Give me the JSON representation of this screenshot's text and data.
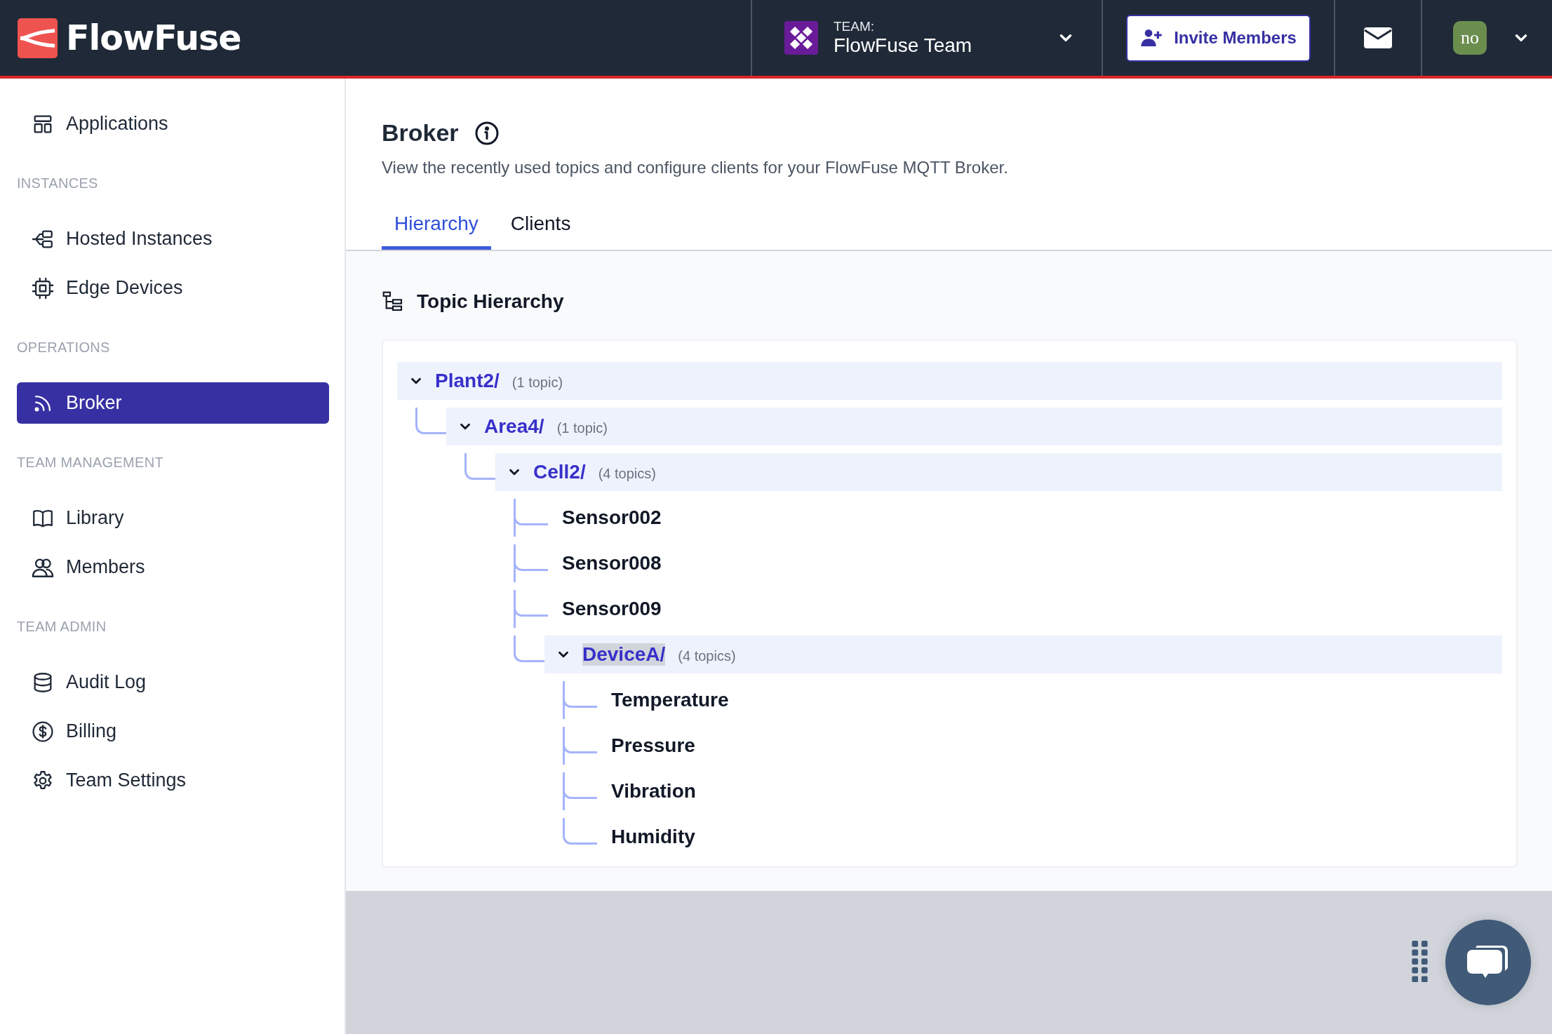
{
  "header": {
    "logo_text": "FlowFuse",
    "team": {
      "label": "TEAM:",
      "name": "FlowFuse Team"
    },
    "invite_button": "Invite Members",
    "avatar_initials": "no"
  },
  "sidebar": {
    "sections": [
      {
        "items": [
          {
            "label": "Applications",
            "kind": "applications",
            "selected": false
          }
        ]
      },
      {
        "title": "INSTANCES",
        "items": [
          {
            "label": "Hosted Instances",
            "kind": "hosted",
            "selected": false
          },
          {
            "label": "Edge Devices",
            "kind": "chip",
            "selected": false
          }
        ]
      },
      {
        "title": "OPERATIONS",
        "items": [
          {
            "label": "Broker",
            "kind": "broker",
            "selected": true
          }
        ]
      },
      {
        "title": "TEAM MANAGEMENT",
        "items": [
          {
            "label": "Library",
            "kind": "book",
            "selected": false
          },
          {
            "label": "Members",
            "kind": "users",
            "selected": false
          }
        ]
      },
      {
        "title": "TEAM ADMIN",
        "items": [
          {
            "label": "Audit Log",
            "kind": "database",
            "selected": false
          },
          {
            "label": "Billing",
            "kind": "dollar",
            "selected": false
          },
          {
            "label": "Team Settings",
            "kind": "gear",
            "selected": false
          }
        ]
      }
    ]
  },
  "page": {
    "title": "Broker",
    "description": "View the recently used topics and configure clients for your FlowFuse MQTT Broker."
  },
  "tabs": [
    {
      "label": "Hierarchy",
      "selected": true
    },
    {
      "label": "Clients",
      "selected": false
    }
  ],
  "tree": {
    "title": "Topic Hierarchy",
    "nodes": [
      {
        "kind": "folder",
        "name": "Plant2/",
        "count": "(1 topic)",
        "expanded": true,
        "selected": false,
        "children": [
          {
            "kind": "folder",
            "name": "Area4/",
            "count": "(1 topic)",
            "expanded": true,
            "selected": false,
            "children": [
              {
                "kind": "folder",
                "name": "Cell2/",
                "count": "(4 topics)",
                "expanded": true,
                "selected": false,
                "children": [
                  {
                    "kind": "topic",
                    "name": "Sensor002",
                    "selected": false
                  },
                  {
                    "kind": "topic",
                    "name": "Sensor008",
                    "selected": false
                  },
                  {
                    "kind": "topic",
                    "name": "Sensor009",
                    "selected": false
                  },
                  {
                    "kind": "folder",
                    "name": "DeviceA/",
                    "count": "(4 topics)",
                    "expanded": true,
                    "selected": true,
                    "children": [
                      {
                        "kind": "topic",
                        "name": "Temperature",
                        "selected": false
                      },
                      {
                        "kind": "topic",
                        "name": "Pressure",
                        "selected": false
                      },
                      {
                        "kind": "topic",
                        "name": "Vibration",
                        "selected": false
                      },
                      {
                        "kind": "topic",
                        "name": "Humidity",
                        "selected": false
                      }
                    ]
                  }
                ]
              }
            ]
          }
        ]
      }
    ]
  }
}
